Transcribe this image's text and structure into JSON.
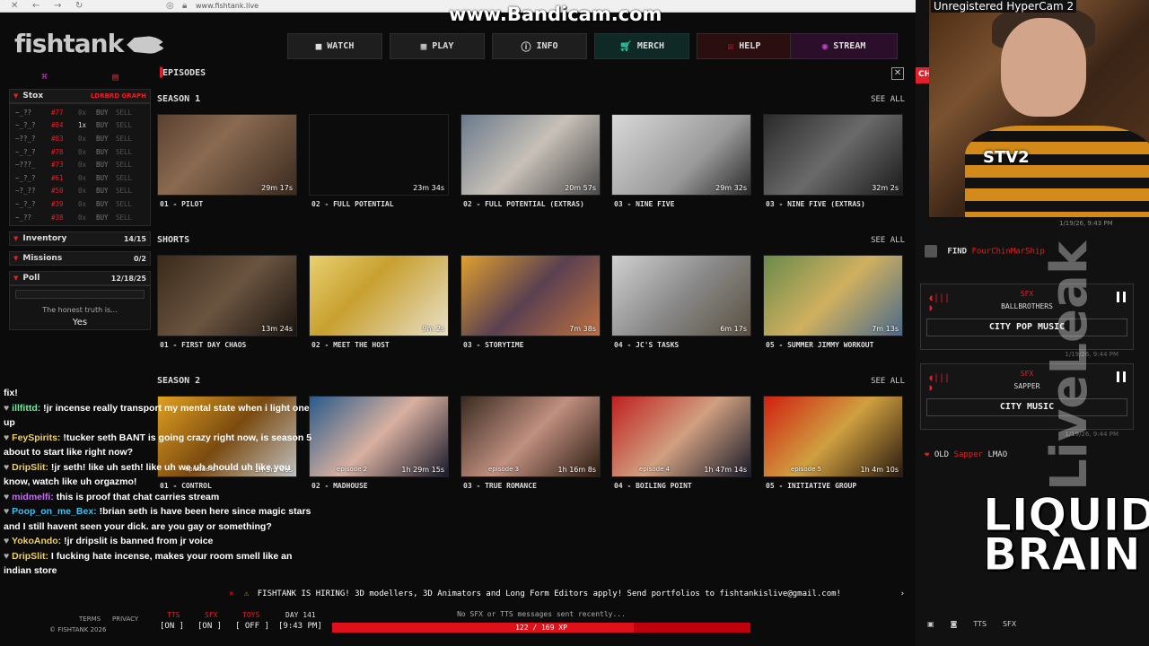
{
  "browser": {
    "url": "www.fishtank.live",
    "watermark": "www.Bandicam.com"
  },
  "logo": {
    "text": "fishtank"
  },
  "nav": [
    {
      "label": "WATCH",
      "icon": "camera-icon"
    },
    {
      "label": "PLAY",
      "icon": "grid-icon"
    },
    {
      "label": "INFO",
      "icon": "info-icon"
    },
    {
      "label": "MERCH",
      "icon": "cart-icon"
    },
    {
      "label": "HELP",
      "icon": "help-icon"
    },
    {
      "label": "STREAM",
      "icon": "stream-icon"
    }
  ],
  "left": {
    "stox": {
      "title": "Stox",
      "controls": "LDRBRD  GRAPH",
      "rows": [
        {
          "sym": "~_??",
          "price": "#77",
          "qty": "0x",
          "buy": "BUY",
          "sell": "SELL"
        },
        {
          "sym": "~_?_?",
          "price": "#84",
          "qty": "1x",
          "buy": "BUY",
          "sell": "SELL"
        },
        {
          "sym": "~??_?",
          "price": "#83",
          "qty": "0x",
          "buy": "BUY",
          "sell": "SELL"
        },
        {
          "sym": "~_?_?",
          "price": "#78",
          "qty": "0x",
          "buy": "BUY",
          "sell": "SELL"
        },
        {
          "sym": "~???_",
          "price": "#73",
          "qty": "0x",
          "buy": "BUY",
          "sell": "SELL"
        },
        {
          "sym": "~_?_?",
          "price": "#61",
          "qty": "0x",
          "buy": "BUY",
          "sell": "SELL"
        },
        {
          "sym": "~?_??",
          "price": "#50",
          "qty": "0x",
          "buy": "BUY",
          "sell": "SELL"
        },
        {
          "sym": "~_?_?",
          "price": "#39",
          "qty": "0x",
          "buy": "BUY",
          "sell": "SELL"
        },
        {
          "sym": "~_??",
          "price": "#38",
          "qty": "0x",
          "buy": "BUY",
          "sell": "SELL"
        }
      ]
    },
    "inventory": {
      "title": "Inventory",
      "count": "14/15"
    },
    "missions": {
      "title": "Missions",
      "count": "0/2"
    },
    "poll": {
      "title": "Poll",
      "date": "12/18/25",
      "question": "The honest truth is...",
      "answer": "Yes"
    }
  },
  "episodes": {
    "header": "EPISODES",
    "sections": [
      {
        "title": "SEASON 1",
        "see_all": "SEE ALL",
        "items": [
          {
            "caption": "01 - PILOT",
            "dur": "29m 17s",
            "bg": "linear-gradient(135deg,#5a4030,#8a6a50 40%,#3a2a20)"
          },
          {
            "caption": "02 - FULL POTENTIAL",
            "dur": "23m 34s",
            "bg": "#0c0c0c"
          },
          {
            "caption": "02 - FULL POTENTIAL (EXTRAS)",
            "dur": "20m 57s",
            "bg": "linear-gradient(135deg,#6a7a8a,#c8c0b8 50%,#4a4a4a)"
          },
          {
            "caption": "03 - NINE FIVE",
            "dur": "29m 32s",
            "bg": "linear-gradient(135deg,#d8d8d8,#9a9a9a 60%,#2a2a2a)"
          },
          {
            "caption": "03 - NINE FIVE (EXTRAS)",
            "dur": "32m 2s",
            "bg": "linear-gradient(135deg,#2a2a2a,#6a6a6a 50%,#1a1a1a)"
          }
        ]
      },
      {
        "title": "SHORTS",
        "see_all": "SEE ALL",
        "items": [
          {
            "caption": "01 - FIRST DAY CHAOS",
            "dur": "13m 24s",
            "bg": "linear-gradient(135deg,#3a2a1a,#6a5440 50%,#1a1410)"
          },
          {
            "caption": "02 - MEET THE HOST",
            "dur": "9m 2s",
            "bg": "linear-gradient(135deg,#e8d070,#c8a030 40%,#e8e0c8)"
          },
          {
            "caption": "03 - STORYTIME",
            "dur": "7m 38s",
            "bg": "linear-gradient(135deg,#e0a030,#5a4050 50%,#c07040)"
          },
          {
            "caption": "04 - JC'S TASKS",
            "dur": "6m 17s",
            "bg": "linear-gradient(135deg,#d0d0d0,#8a8a8a 50%,#5a5040)"
          },
          {
            "caption": "05 - SUMMER JIMMY WORKOUT",
            "dur": "7m 13s",
            "bg": "linear-gradient(135deg,#6a8a4a,#d0b060 50%,#4a6a8a)"
          }
        ]
      },
      {
        "title": "SEASON 2",
        "see_all": "SEE ALL",
        "items": [
          {
            "caption": "01 - CONTROL",
            "dur": "1h 5m 46s",
            "ep": "episode 1",
            "bg": "linear-gradient(135deg,#e0a020,#7a4a10 50%,#c0c0c0)"
          },
          {
            "caption": "02 - MADHOUSE",
            "dur": "1h 29m 15s",
            "ep": "episode 2",
            "bg": "linear-gradient(135deg,#2a5a8a,#d8b0a0 50%,#1a1a2a)"
          },
          {
            "caption": "03 - TRUE ROMANCE",
            "dur": "1h 16m 8s",
            "ep": "episode 3",
            "bg": "linear-gradient(135deg,#3a2a20,#c09080 50%,#2a1a10)"
          },
          {
            "caption": "04 - BOILING POINT",
            "dur": "1h 47m 14s",
            "ep": "episode 4",
            "bg": "linear-gradient(135deg,#c02020,#d0a080 50%,#1a1a2a)"
          },
          {
            "caption": "05 - INITIATIVE GROUP",
            "dur": "1h 4m 10s",
            "ep": "episode 5",
            "bg": "linear-gradient(135deg,#d02010,#d0a040 50%,#2a1a10)"
          }
        ]
      }
    ]
  },
  "chat": [
    {
      "user": "",
      "msg": "fix!",
      "color": "#fff"
    },
    {
      "user": "illfittd:",
      "msg": "!jr incense really transport my mental state when i light one up",
      "color": "#6cf0a0"
    },
    {
      "user": "FeySpirits:",
      "msg": "!tucker seth BANT is going crazy right now, is season 5 about to start like right now?",
      "color": "#f0d060"
    },
    {
      "user": "DripSlit:",
      "msg": "!jr seth! like uh seth! like uh we uh should uh like you know, watch like uh orgazmo!",
      "color": "#f0d060"
    },
    {
      "user": "midmelfi:",
      "msg": "this is proof that chat carries stream",
      "color": "#c070f0"
    },
    {
      "user": "Poop_on_me_Bex:",
      "msg": "!brian seth is have been here since magic stars and I still havent seen your dick. are you gay or something?",
      "color": "#40c0f0"
    },
    {
      "user": "YokoAndo:",
      "msg": "!jr dripslit is banned from jr voice",
      "color": "#f0d060"
    },
    {
      "user": "DripSlit:",
      "msg": "I fucking hate incense, makes your room smell like an indian store",
      "color": "#f0d060"
    }
  ],
  "footer": {
    "notice": "FISHTANK IS HIRING! 3D modellers, 3D Animators and Long Form Editors apply! Send portfolios to fishtankislive@gmail.com!",
    "sfx_msg": "No SFX or TTS messages sent recently...",
    "xp": "122 / 169 XP",
    "xp_fraction": 0.72,
    "toggles": [
      "[ON ]",
      "[ON ]",
      "[ OFF ]",
      "[9:43 PM]"
    ],
    "toggle_labels": [
      "TTS",
      "SFX",
      "TOYS",
      "DAY 141"
    ],
    "copyright": "© FISHTANK 2026",
    "privacy": "PRIVACY",
    "terms": "TERMS"
  },
  "right": {
    "overlay": "Unregistered HyperCam 2",
    "cam_label": "STV2",
    "cam_time": "1/19/26, 9:43 PM",
    "tab": "CH",
    "find_label": "FIND",
    "find_user": "FourChinMarShip",
    "sfx": [
      {
        "tag": "SFX",
        "who": "BALLBROTHERS",
        "title": "CITY POP MUSIC",
        "time": "1/19/26, 9:44 PM"
      },
      {
        "tag": "SFX",
        "who": "SAPPER",
        "title": "CITY MUSIC",
        "time": "1/19/26, 9:44 PM"
      }
    ],
    "old_label": "OLD",
    "old_user": "Sapper",
    "old_msg": "LMAO",
    "liveleak": "LiveLeak",
    "liquid": "LIQUID BRAIN",
    "bottom": [
      "TTS",
      "SFX"
    ]
  }
}
